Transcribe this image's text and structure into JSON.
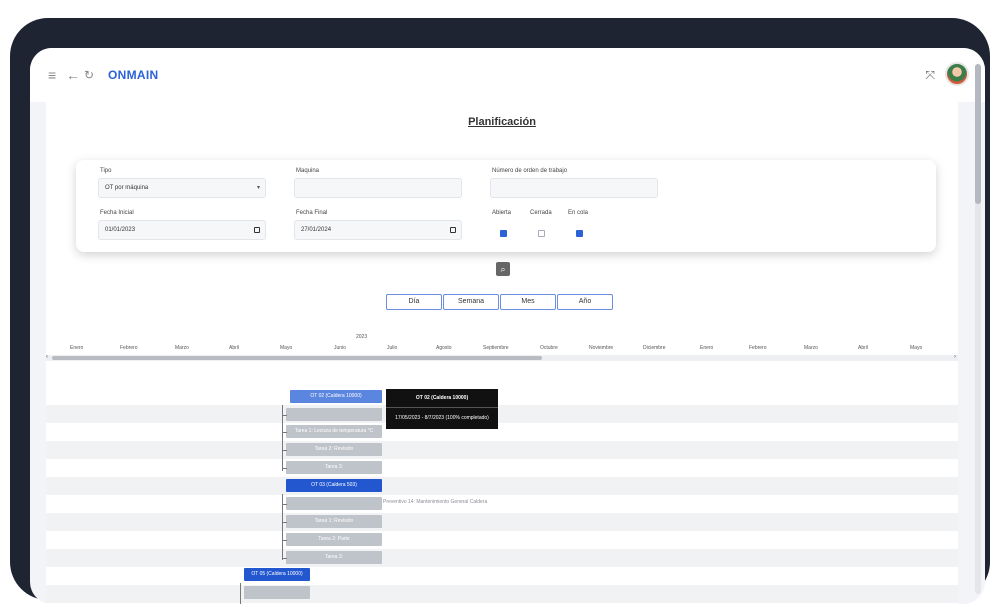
{
  "header": {
    "brand": "ONMAIN",
    "menu_icon": "hamburger-icon",
    "back_icon": "arrow-left-icon",
    "refresh_icon": "refresh-icon",
    "expand_icon": "expand-icon"
  },
  "page": {
    "title": "Planificación"
  },
  "filters": {
    "tipo_label": "Tipo",
    "tipo_value": "OT por máquina",
    "maquina_label": "Maquina",
    "maquina_value": "",
    "orden_label": "Número de orden de trabajo",
    "orden_value": "",
    "fecha_inicial_label": "Fecha Inicial",
    "fecha_inicial_value": "01/01/2023",
    "fecha_final_label": "Fecha Final",
    "fecha_final_value": "27/01/2024",
    "estados": [
      {
        "label": "Abierta",
        "checked": true
      },
      {
        "label": "Cerrada",
        "checked": false
      },
      {
        "label": "En cola",
        "checked": true
      }
    ]
  },
  "views": [
    "Día",
    "Semana",
    "Mes",
    "Año"
  ],
  "timeline": {
    "year": "2023",
    "months": [
      "Enero",
      "Febrero",
      "Marzo",
      "Abril",
      "Mayo",
      "Junio",
      "Julio",
      "Agosto",
      "Septiembre",
      "Octubre",
      "Noviembre",
      "Diciembre",
      "Enero",
      "Febrero",
      "Marzo",
      "Abril",
      "Mayo"
    ]
  },
  "gantt": {
    "tasks": [
      "OT 02 (Caldera 10000)",
      "Tarea 1: Lectura de temperatura °C",
      "Tarea 2: Revisión",
      "Tarea 3:",
      "OT 03 (Caldera 503)",
      "Tarea 1: Revisión",
      "Tarea 2: Parte",
      "Tarea 3:",
      "OT 05 (Caldera 10000)"
    ],
    "tooltip_title": "OT 02 (Caldera 10000)",
    "tooltip_detail": "17/05/2023 - 8/7/2023  (100% completado)",
    "side_label": "Preventivo 14: Mantenimiento General Caldera"
  },
  "colors": {
    "accent": "#2b62d6",
    "bar_blue": "#5b86df",
    "bar_grey": "#bfc3ca"
  }
}
